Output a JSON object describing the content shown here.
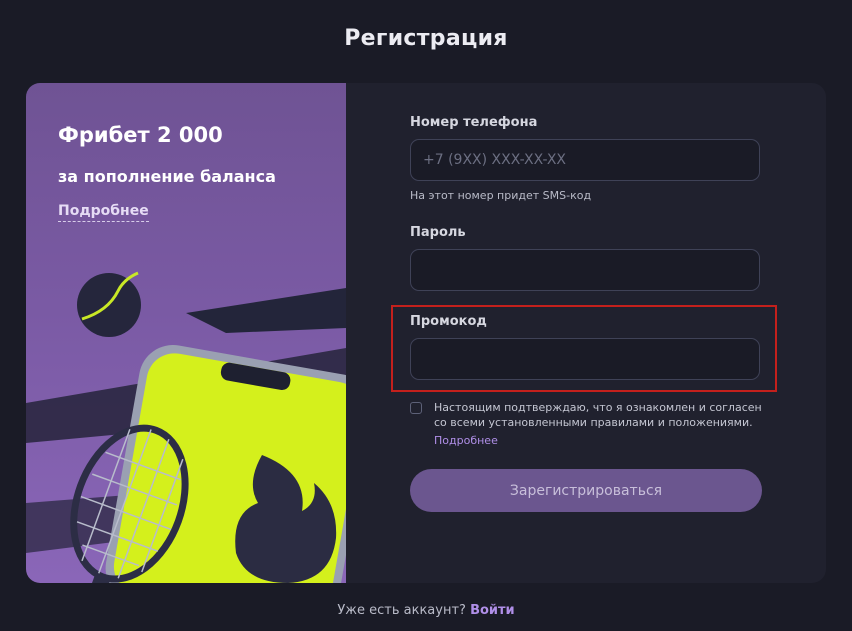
{
  "page": {
    "title": "Регистрация"
  },
  "promo": {
    "title": "Фрибет 2 000",
    "subtitle": "за пополнение баланса",
    "more_link": "Подробнее"
  },
  "form": {
    "phone": {
      "label": "Номер телефона",
      "placeholder": "+7 (9XX) XXX-XX-XX",
      "value": "",
      "hint": "На этот номер придет SMS-код"
    },
    "password": {
      "label": "Пароль",
      "value": ""
    },
    "promocode": {
      "label": "Промокод",
      "value": ""
    },
    "consent": {
      "checked": false,
      "line1": "Настоящим подтверждаю, что я ознакомлен и согласен",
      "line2": "со всеми установленными правилами и положениями.",
      "link": "Подробнее"
    },
    "submit_label": "Зарегистрироваться"
  },
  "footer": {
    "question": "Уже есть аккаунт?",
    "login_link": "Войти"
  },
  "colors": {
    "background": "#1a1b26",
    "card": "#20212e",
    "accent": "#b08fe8",
    "button": "#6b568f",
    "highlight": "#c4201c",
    "phone_screen": "#d4f01c"
  },
  "icons": {
    "checkbox": "checkbox-empty-icon"
  }
}
